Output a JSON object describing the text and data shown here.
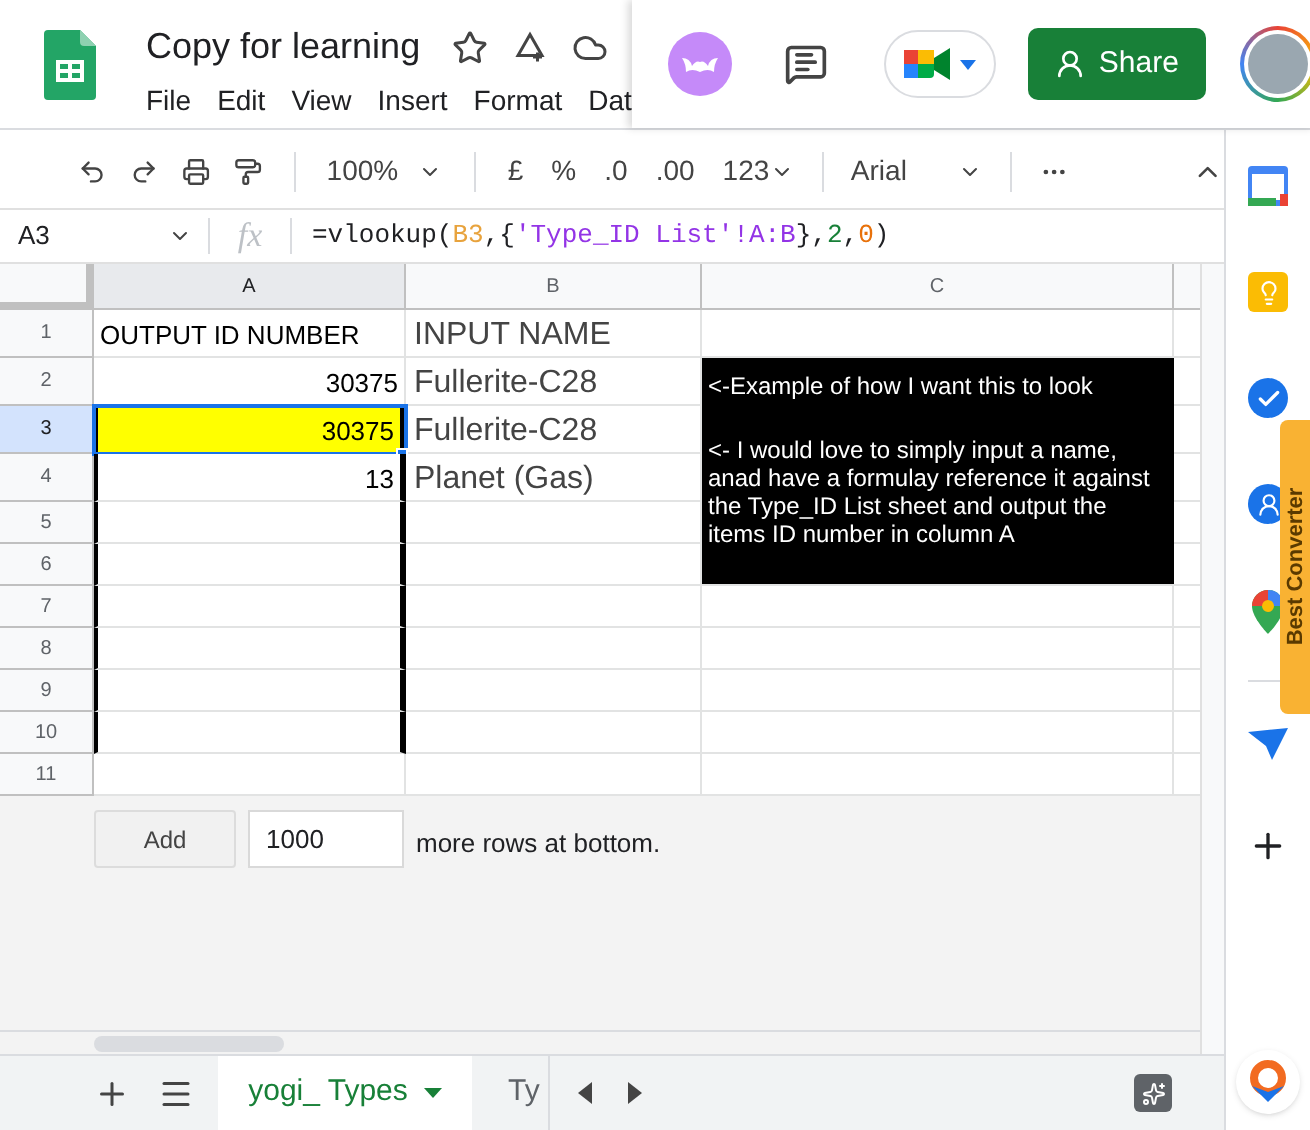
{
  "header": {
    "title": "Copy for learning",
    "menu": [
      "File",
      "Edit",
      "View",
      "Insert",
      "Format",
      "Dat"
    ],
    "share_label": "Share"
  },
  "toolbar": {
    "zoom": "100%",
    "currency": "£",
    "percent": "%",
    "decrease_decimals": ".0",
    "increase_decimals": ".00",
    "number_format": "123",
    "font": "Arial"
  },
  "formula_bar": {
    "cell_ref": "A3",
    "fx": "fx",
    "formula": [
      {
        "text": "=vlookup(",
        "color": "#202124"
      },
      {
        "text": "B3",
        "color": "#e8a33d"
      },
      {
        "text": ",{",
        "color": "#202124"
      },
      {
        "text": "'Type_ID List'!A:B",
        "color": "#9334e6"
      },
      {
        "text": "},",
        "color": "#202124"
      },
      {
        "text": "2",
        "color": "#188038"
      },
      {
        "text": ",",
        "color": "#202124"
      },
      {
        "text": "0",
        "color": "#e8710a"
      },
      {
        "text": ")",
        "color": "#202124"
      }
    ]
  },
  "columns": [
    {
      "label": "A",
      "selected": true
    },
    {
      "label": "B",
      "selected": false
    },
    {
      "label": "C",
      "selected": false
    }
  ],
  "rows": [
    {
      "number": "1",
      "selected": false,
      "a": "OUTPUT ID NUMBER",
      "b": "INPUT NAME",
      "a_numeric": false,
      "a_highlight": false,
      "a_selected": false,
      "outlined": false
    },
    {
      "number": "2",
      "selected": false,
      "a": "30375",
      "b": "Fullerite-C28",
      "a_numeric": true,
      "a_highlight": false,
      "a_selected": false,
      "outlined": false,
      "note": [
        "<-Example of how I want this to look",
        "<- I would love to simply input a name, anad have a formulay reference it against the Type_ID List sheet and output the items ID number in column A"
      ]
    },
    {
      "number": "3",
      "selected": true,
      "a": "30375",
      "b": "Fullerite-C28",
      "a_numeric": true,
      "a_highlight": true,
      "a_selected": true,
      "outlined": true
    },
    {
      "number": "4",
      "selected": false,
      "a": "13",
      "b": "Planet (Gas)",
      "a_numeric": true,
      "a_highlight": false,
      "a_selected": false,
      "outlined": true
    },
    {
      "number": "5",
      "selected": false,
      "outlined": true
    },
    {
      "number": "6",
      "selected": false,
      "outlined": true
    },
    {
      "number": "7",
      "selected": false,
      "outlined": true
    },
    {
      "number": "8",
      "selected": false,
      "outlined": true
    },
    {
      "number": "9",
      "selected": false,
      "outlined": true
    },
    {
      "number": "10",
      "selected": false,
      "outlined": true
    },
    {
      "number": "11",
      "selected": false,
      "outlined": false
    }
  ],
  "add_rows": {
    "button": "Add",
    "value": "1000",
    "suffix": "more rows at bottom."
  },
  "sheet_tabs": [
    {
      "label": "yogi_ Types",
      "selected": true
    },
    {
      "label": "Ty",
      "selected": false
    }
  ],
  "side_panel": {
    "extension_tab": "Best Converter"
  }
}
